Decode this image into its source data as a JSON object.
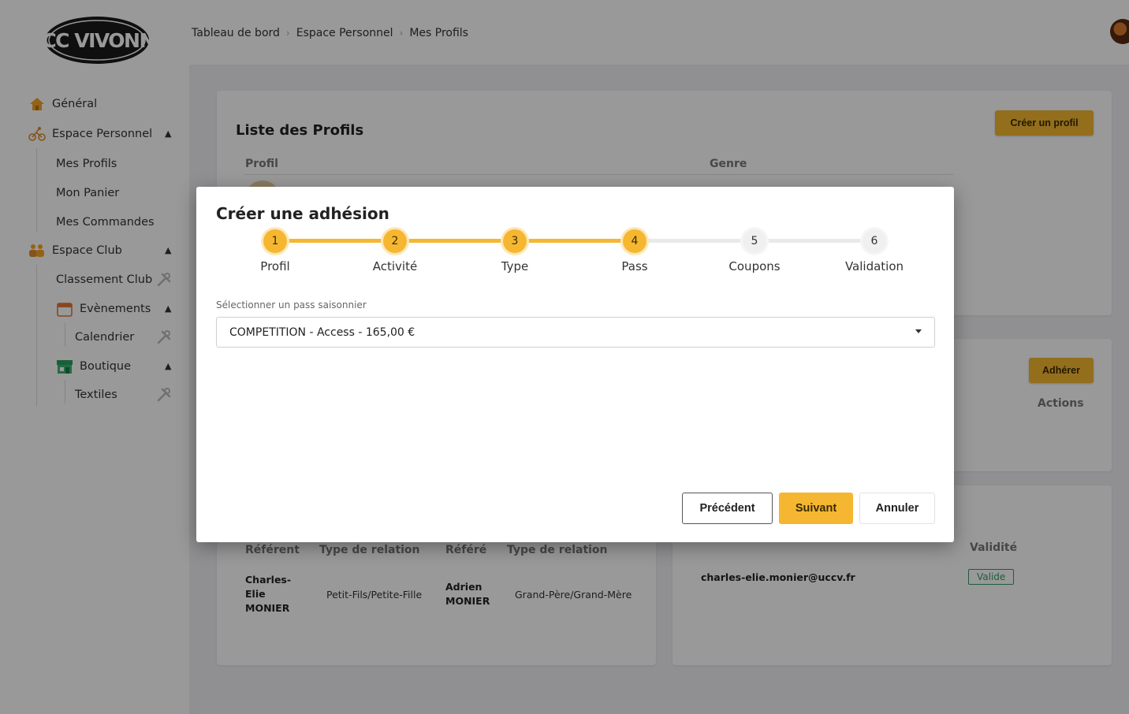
{
  "brand": {
    "logo_text": "UCC VIVONNE",
    "accent": "#f5b731"
  },
  "breadcrumb": [
    "Tableau de bord",
    "Espace Personnel",
    "Mes Profils"
  ],
  "sidebar": {
    "general": "Général",
    "espace_personnel": "Espace Personnel",
    "mes_profils": "Mes Profils",
    "mon_panier": "Mon Panier",
    "mes_commandes": "Mes Commandes",
    "espace_club": "Espace Club",
    "classement_club": "Classement Club",
    "evenements": "Evènements",
    "calendrier": "Calendrier",
    "boutique": "Boutique",
    "textiles": "Textiles"
  },
  "profiles_card": {
    "title": "Liste des Profils",
    "create_button": "Créer un profil",
    "col_profil": "Profil",
    "col_genre": "Genre"
  },
  "second_card": {
    "adherer_button": "Adhérer",
    "col_actions": "Actions"
  },
  "relations_card": {
    "col_referent": "Référent",
    "col_type_relation": "Type de relation",
    "col_refere": "Référé",
    "col_type_relation_2": "Type de relation",
    "referent_name": "Charles-Elie MONIER",
    "relation_1": "Petit-Fils/Petite-Fille",
    "refere_name": "Adrien MONIER",
    "relation_2": "Grand-Père/Grand-Mère"
  },
  "email_card": {
    "col_validite": "Validité",
    "email": "charles-elie.monier@uccv.fr",
    "status": "Valide",
    "status_color": "#2e9e62"
  },
  "modal": {
    "title": "Créer une adhésion",
    "steps": [
      {
        "number": "1",
        "label": "Profil",
        "state": "done"
      },
      {
        "number": "2",
        "label": "Activité",
        "state": "done"
      },
      {
        "number": "3",
        "label": "Type",
        "state": "done"
      },
      {
        "number": "4",
        "label": "Pass",
        "state": "current"
      },
      {
        "number": "5",
        "label": "Coupons",
        "state": "todo"
      },
      {
        "number": "6",
        "label": "Validation",
        "state": "todo"
      }
    ],
    "field_label": "Sélectionner un pass saisonnier",
    "selected_pass": "COMPETITION - Access - 165,00 €",
    "btn_previous": "Précédent",
    "btn_next": "Suivant",
    "btn_cancel": "Annuler"
  }
}
